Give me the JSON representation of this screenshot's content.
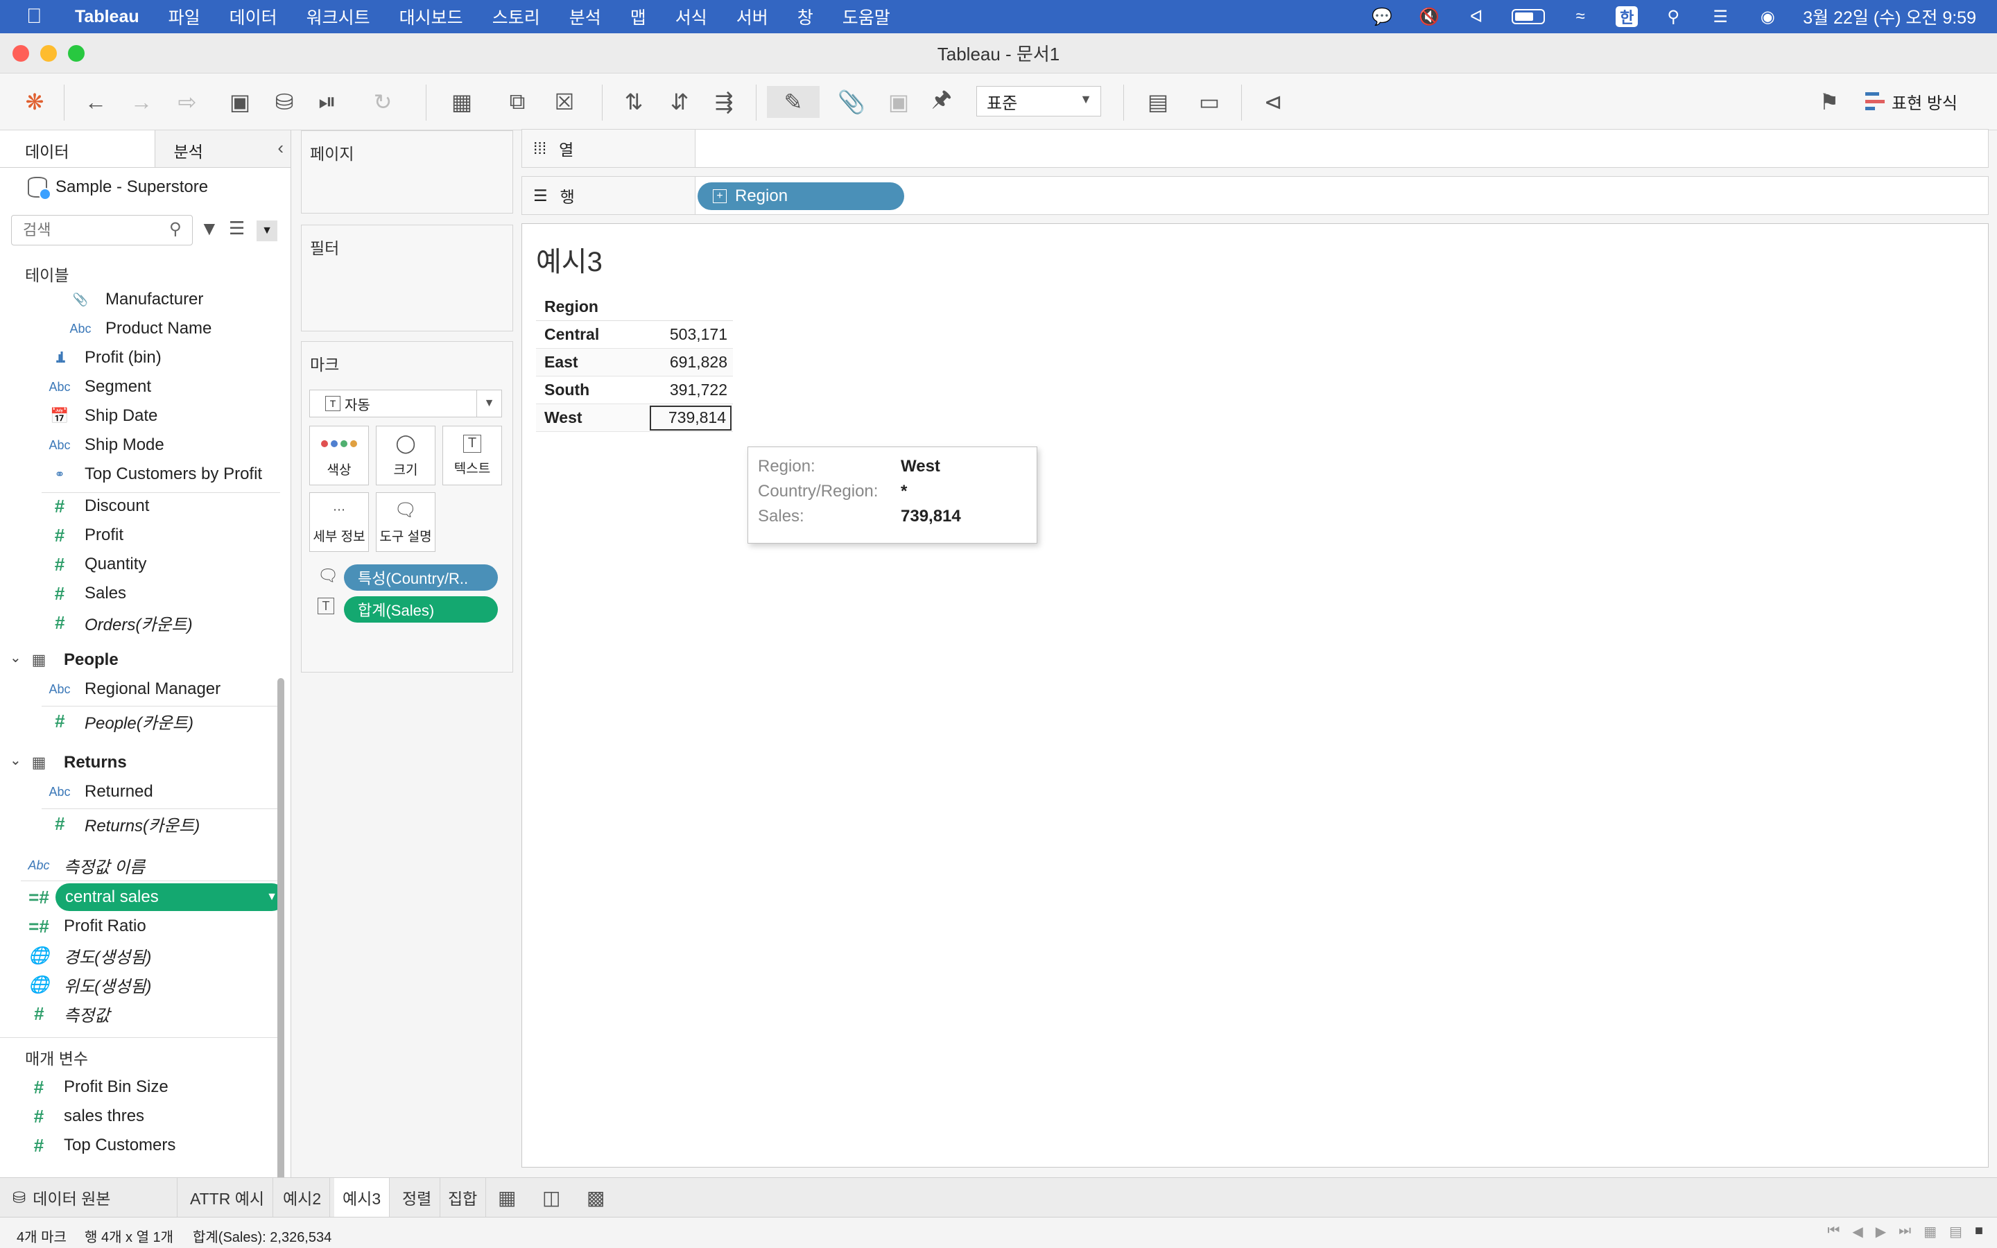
{
  "menubar": {
    "app": "Tableau",
    "items": [
      "파일",
      "데이터",
      "워크시트",
      "대시보드",
      "스토리",
      "분석",
      "맵",
      "서식",
      "서버",
      "창",
      "도움말"
    ],
    "ime": "한",
    "datetime": "3월 22일 (수) 오전 9:59"
  },
  "window": {
    "title": "Tableau - 문서1"
  },
  "toolbar": {
    "mark_standard": "표준",
    "show_me": "표현 방식"
  },
  "data_pane": {
    "tab_data": "데이터",
    "tab_analysis": "분석",
    "datasource": "Sample - Superstore",
    "search_placeholder": "검색",
    "tables_label": "테이블",
    "orders_fields": [
      {
        "name": "Manufacturer",
        "type": "link"
      },
      {
        "name": "Product Name",
        "type": "abc"
      },
      {
        "name": "Profit (bin)",
        "type": "bin"
      },
      {
        "name": "Segment",
        "type": "abc"
      },
      {
        "name": "Ship Date",
        "type": "date"
      },
      {
        "name": "Ship Mode",
        "type": "abc"
      },
      {
        "name": "Top Customers by Profit",
        "type": "set"
      }
    ],
    "orders_measures": [
      "Discount",
      "Profit",
      "Quantity",
      "Sales",
      "Orders(카운트)"
    ],
    "people_table": "People",
    "people_fields": [
      "Regional Manager",
      "People(카운트)"
    ],
    "returns_table": "Returns",
    "returns_fields": [
      "Returned",
      "Returns(카운트)"
    ],
    "global_fields": [
      "측정값 이름",
      "central sales",
      "Profit Ratio",
      "경도(생성됨)",
      "위도(생성됨)",
      "측정값"
    ],
    "params_label": "매개 변수",
    "params": [
      "Profit Bin Size",
      "sales thres",
      "Top Customers"
    ]
  },
  "cards": {
    "pages": "페이지",
    "filters": "필터",
    "marks": "마크",
    "mark_type": "자동",
    "buttons": [
      "색상",
      "크기",
      "텍스트",
      "세부 정보",
      "도구 설명"
    ],
    "pills": [
      "특성(Country/R..",
      "합계(Sales)"
    ]
  },
  "shelves": {
    "columns": "열",
    "rows": "행",
    "rows_pill": "Region"
  },
  "viz": {
    "title": "예시3",
    "header": "Region",
    "rows": [
      {
        "region": "Central",
        "sales": "503,171"
      },
      {
        "region": "East",
        "sales": "691,828"
      },
      {
        "region": "South",
        "sales": "391,722"
      },
      {
        "region": "West",
        "sales": "739,814"
      }
    ],
    "tooltip": [
      {
        "key": "Region:",
        "value": "West"
      },
      {
        "key": "Country/Region:",
        "value": "*"
      },
      {
        "key": "Sales:",
        "value": "739,814"
      }
    ]
  },
  "sheet_tabs": {
    "datasource": "데이터 원본",
    "tabs": [
      "ATTR 예시",
      "예시2",
      "예시3",
      "정렬",
      "집합"
    ],
    "active": "예시3"
  },
  "status": {
    "marks": "4개 마크",
    "rows_cols": "행 4개 x 열 1개",
    "sum": "합계(Sales): 2,326,534"
  },
  "colors": {
    "menubar": "#3366c2",
    "green_pill": "#14a870",
    "blue_pill": "#4a90b8"
  }
}
